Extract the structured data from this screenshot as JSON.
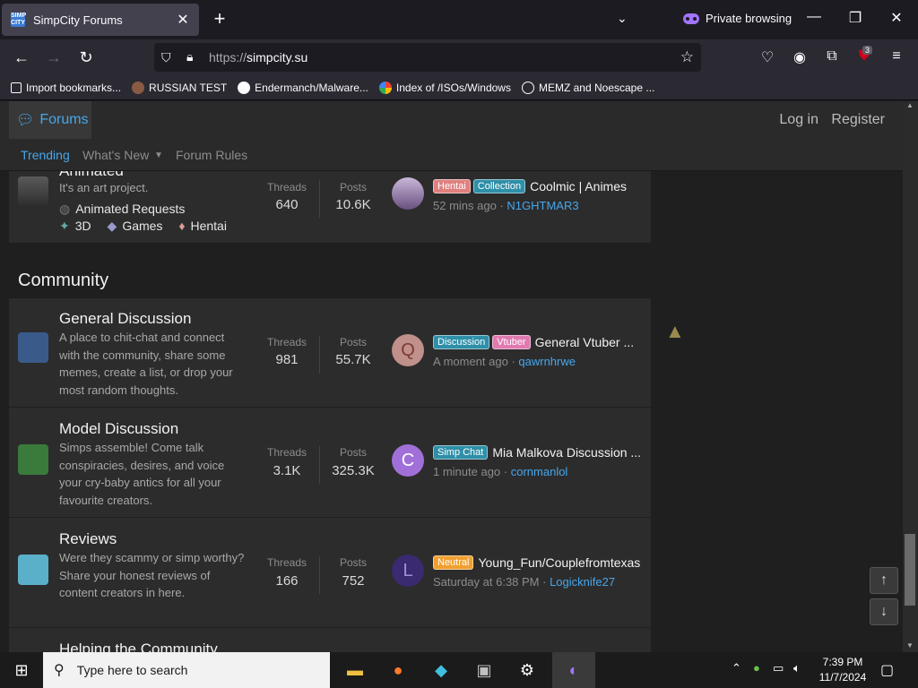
{
  "browser": {
    "tab_title": "SimpCity Forums",
    "tab_favicon_text": "SIMP CITY",
    "private_label": "Private browsing",
    "url_scheme": "https://",
    "url_host": "simpcity.su",
    "extension_badge": "3",
    "bookmarks": [
      {
        "label": "Import bookmarks...",
        "icon": "import-icon"
      },
      {
        "label": "RUSSIAN TEST",
        "icon": "globe-icon"
      },
      {
        "label": "Endermanch/Malware...",
        "icon": "github-icon"
      },
      {
        "label": "Index of /ISOs/Windows",
        "icon": "google-icon"
      },
      {
        "label": "MEMZ and Noescape ...",
        "icon": "globe-icon"
      }
    ]
  },
  "site": {
    "forums_label": "Forums",
    "login_label": "Log in",
    "register_label": "Register",
    "subnav": [
      "Trending",
      "What's New",
      "Forum Rules"
    ],
    "top_node": {
      "title": "Animated",
      "desc": "It's an art project.",
      "threads_label": "Threads",
      "threads": "640",
      "posts_label": "Posts",
      "posts": "10.6K",
      "tags": [
        "Hentai",
        "Collection"
      ],
      "thread": "Coolmic | Animes",
      "time": "52 mins ago",
      "user": "N1GHTMAR3",
      "sub_forums": [
        "Animated Requests",
        "3D",
        "Games",
        "Hentai"
      ]
    },
    "category": "Community",
    "nodes": [
      {
        "title": "General Discussion",
        "desc": "A place to chit-chat and connect with the community, share some memes, create a list, or drop your most random thoughts.",
        "threads_label": "Threads",
        "threads": "981",
        "posts_label": "Posts",
        "posts": "55.7K",
        "avatar_letter": "Q",
        "tags": [
          "Discussion",
          "Vtuber"
        ],
        "thread": "General Vtuber ...",
        "time": "A moment ago",
        "user": "qawrnhrwe"
      },
      {
        "title": "Model Discussion",
        "desc": "Simps assemble! Come talk conspiracies, desires, and voice your cry-baby antics for all your favourite creators.",
        "threads_label": "Threads",
        "threads": "3.1K",
        "posts_label": "Posts",
        "posts": "325.3K",
        "avatar_letter": "C",
        "tags": [
          "Simp Chat"
        ],
        "thread": "Mia Malkova Discussion ...",
        "time": "1 minute ago",
        "user": "cornmanlol"
      },
      {
        "title": "Reviews",
        "desc": "Were they scammy or simp worthy? Share your honest reviews of content creators in here.",
        "threads_label": "Threads",
        "threads": "166",
        "posts_label": "Posts",
        "posts": "752",
        "avatar_letter": "L",
        "tags": [
          "Neutral"
        ],
        "thread": "Young_Fun/Couplefromtexas",
        "time": "Saturday at 6:38 PM",
        "user": "Logicknife27"
      },
      {
        "title": "Helping the Community"
      }
    ]
  },
  "taskbar": {
    "search_placeholder": "Type here to search",
    "time": "7:39 PM",
    "date": "11/7/2024"
  },
  "colors": {
    "accent": "#47a7eb",
    "tag_hentai": "#e08080",
    "tag_collection": "#2f8fa8",
    "tag_discussion": "#2f8fa8",
    "tag_vtuber": "#e07ab0",
    "tag_simpchat": "#2f8fa8",
    "tag_neutral": "#f0a030"
  }
}
